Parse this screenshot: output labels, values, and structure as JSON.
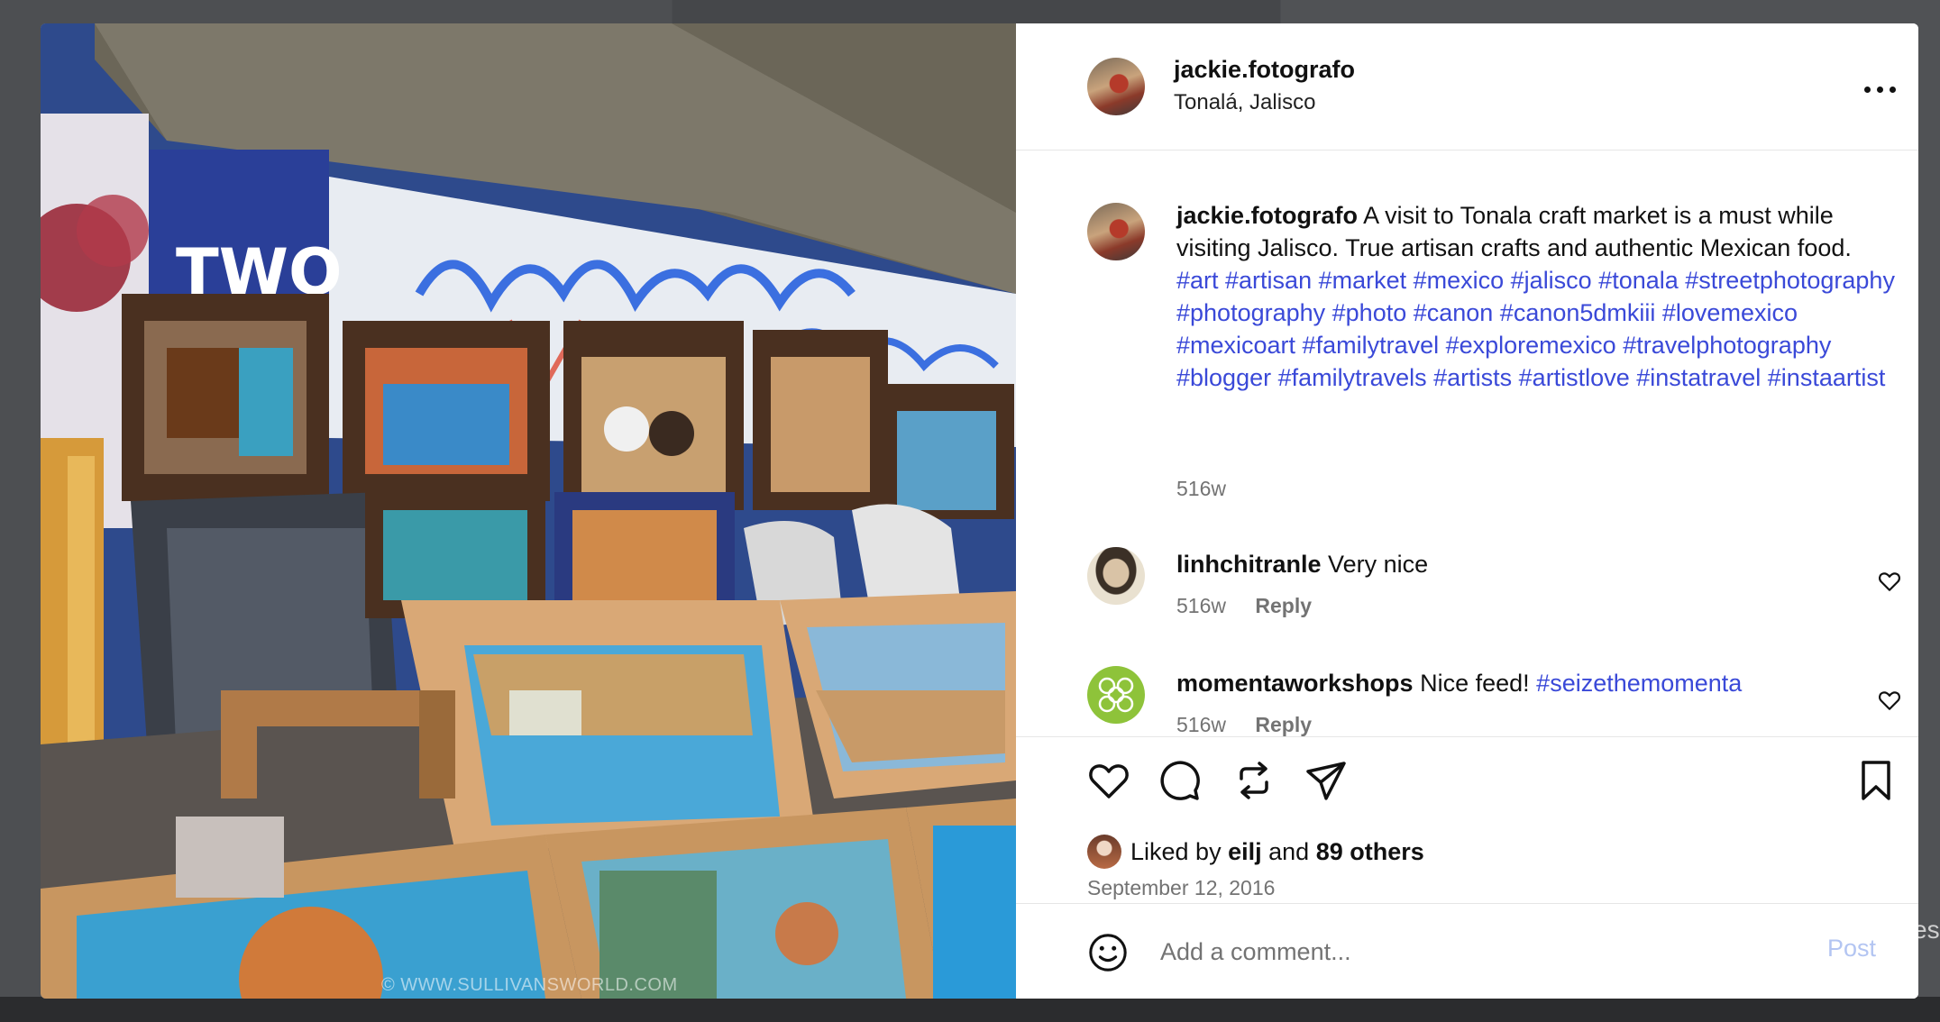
{
  "background": {
    "edge_text": "es"
  },
  "photo": {
    "watermark": "© WWW.SULLIVANSWORLD.COM",
    "graffiti_text": "TWO"
  },
  "post": {
    "username": "jackie.fotografo",
    "location": "Tonalá, Jalisco",
    "more_icon": "more-horizontal-icon",
    "caption": {
      "username": "jackie.fotografo",
      "text": "A visit to Tonala craft market is a must while visiting Jalisco. True artisan crafts and authentic Mexican food.",
      "hashtags": "#art #artisan #market #mexico #jalisco #tonala #streetphotography #photography #photo #canon #canon5dmkiii #lovemexico #mexicoart #familytravel #exploremexico #travelphotography #blogger #familytravels #artists #artistlove #instatravel #instaartist",
      "time": "516w"
    },
    "comments": [
      {
        "username": "linhchitranle",
        "text": "Very nice",
        "hashtag": "",
        "time": "516w",
        "reply_label": "Reply"
      },
      {
        "username": "momentaworkshops",
        "text": "Nice feed!",
        "hashtag": "#seizethemomenta",
        "time": "516w",
        "reply_label": "Reply"
      }
    ],
    "actions": {
      "icons": [
        "heart-icon",
        "comment-icon",
        "repost-icon",
        "share-icon",
        "bookmark-icon"
      ]
    },
    "likes": {
      "prefix": "Liked by",
      "user": "eilj",
      "conjunction": "and",
      "others": "89 others"
    },
    "date": "September 12, 2016",
    "add_comment": {
      "placeholder": "Add a comment...",
      "post_label": "Post"
    }
  },
  "colors": {
    "hashtag": "#3a49d8",
    "post_button": "#b3c5f2",
    "muted_text": "#737373"
  }
}
